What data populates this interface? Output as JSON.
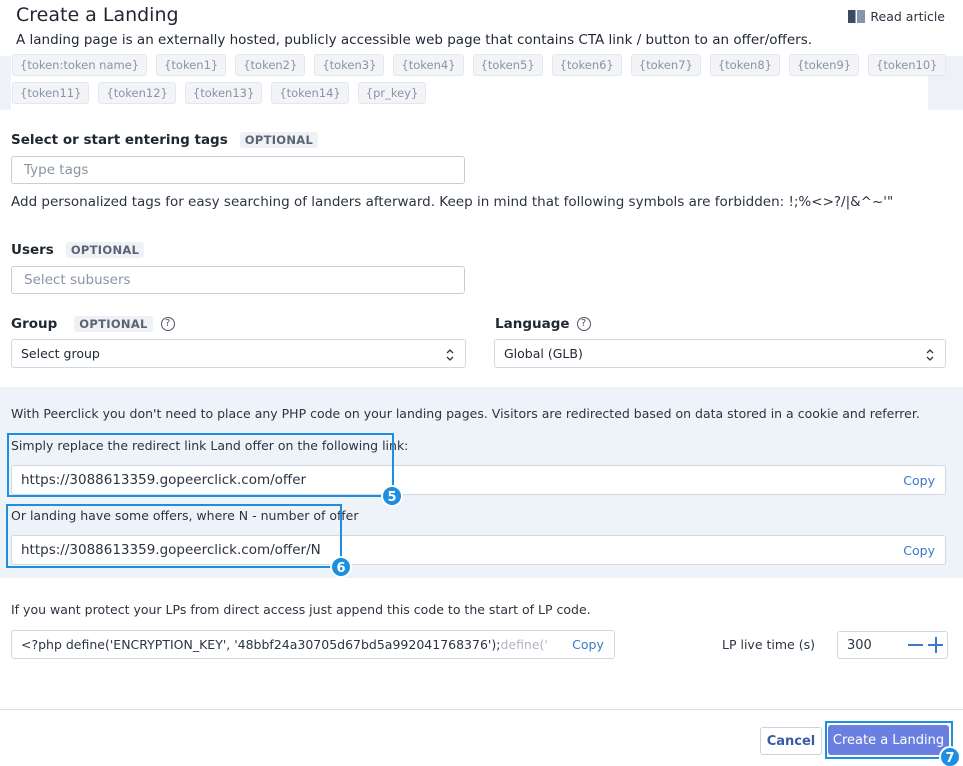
{
  "header": {
    "title": "Create a Landing",
    "subtitle": "A landing page is an externally hosted, publicly accessible web page that contains CTA link / button to an offer/offers.",
    "read_article": "Read article"
  },
  "tokens": {
    "row1": [
      "{token:token name}",
      "{token1}",
      "{token2}",
      "{token3}",
      "{token4}",
      "{token5}",
      "{token6}",
      "{token7}",
      "{token8}",
      "{token9}",
      "{token10}"
    ],
    "row2": [
      "{token11}",
      "{token12}",
      "{token13}",
      "{token14}",
      "{pr_key}"
    ]
  },
  "tags": {
    "label": "Select or start entering tags",
    "optional": "OPTIONAL",
    "placeholder": "Type tags",
    "hint": "Add personalized tags for easy searching of landers afterward. Keep in mind that following symbols are forbidden: !;%<>?/|&^~'\""
  },
  "users": {
    "label": "Users",
    "optional": "OPTIONAL",
    "placeholder": "Select subusers"
  },
  "group": {
    "label": "Group",
    "optional": "OPTIONAL",
    "help": "?",
    "value": "Select group"
  },
  "language": {
    "label": "Language",
    "help": "?",
    "value": "Global (GLB)"
  },
  "info": {
    "intro": "With Peerclick you don't need to place any PHP code on your landing pages. Visitors are redirected based on data stored in a cookie and referrer.",
    "replace_label": "Simply replace the redirect link Land offer on the following link:",
    "replace_link": "https://3088613359.gopeerclick.com/offer",
    "multi_label": "Or landing have some offers, where N - number of offer",
    "multi_link": "https://3088613359.gopeerclick.com/offer/N",
    "copy": "Copy"
  },
  "protect": {
    "text": "If you want protect your LPs from direct access just append this code to the start of LP code.",
    "code": "<?php define('ENCRYPTION_KEY', '48bbf24a30705d67bd5a992041768376'); ",
    "code_fade": "define('",
    "copy": "Copy",
    "lp_label": "LP live time (s)",
    "lp_value": "300"
  },
  "badges": {
    "b5": "5",
    "b6": "6",
    "b7": "7"
  },
  "footer": {
    "cancel": "Cancel",
    "create": "Create a Landing"
  },
  "colors": {
    "accent": "#1d8fe0",
    "primary_button": "#6b7fe0",
    "link": "#3a78c8",
    "panel": "#eef2f9"
  }
}
